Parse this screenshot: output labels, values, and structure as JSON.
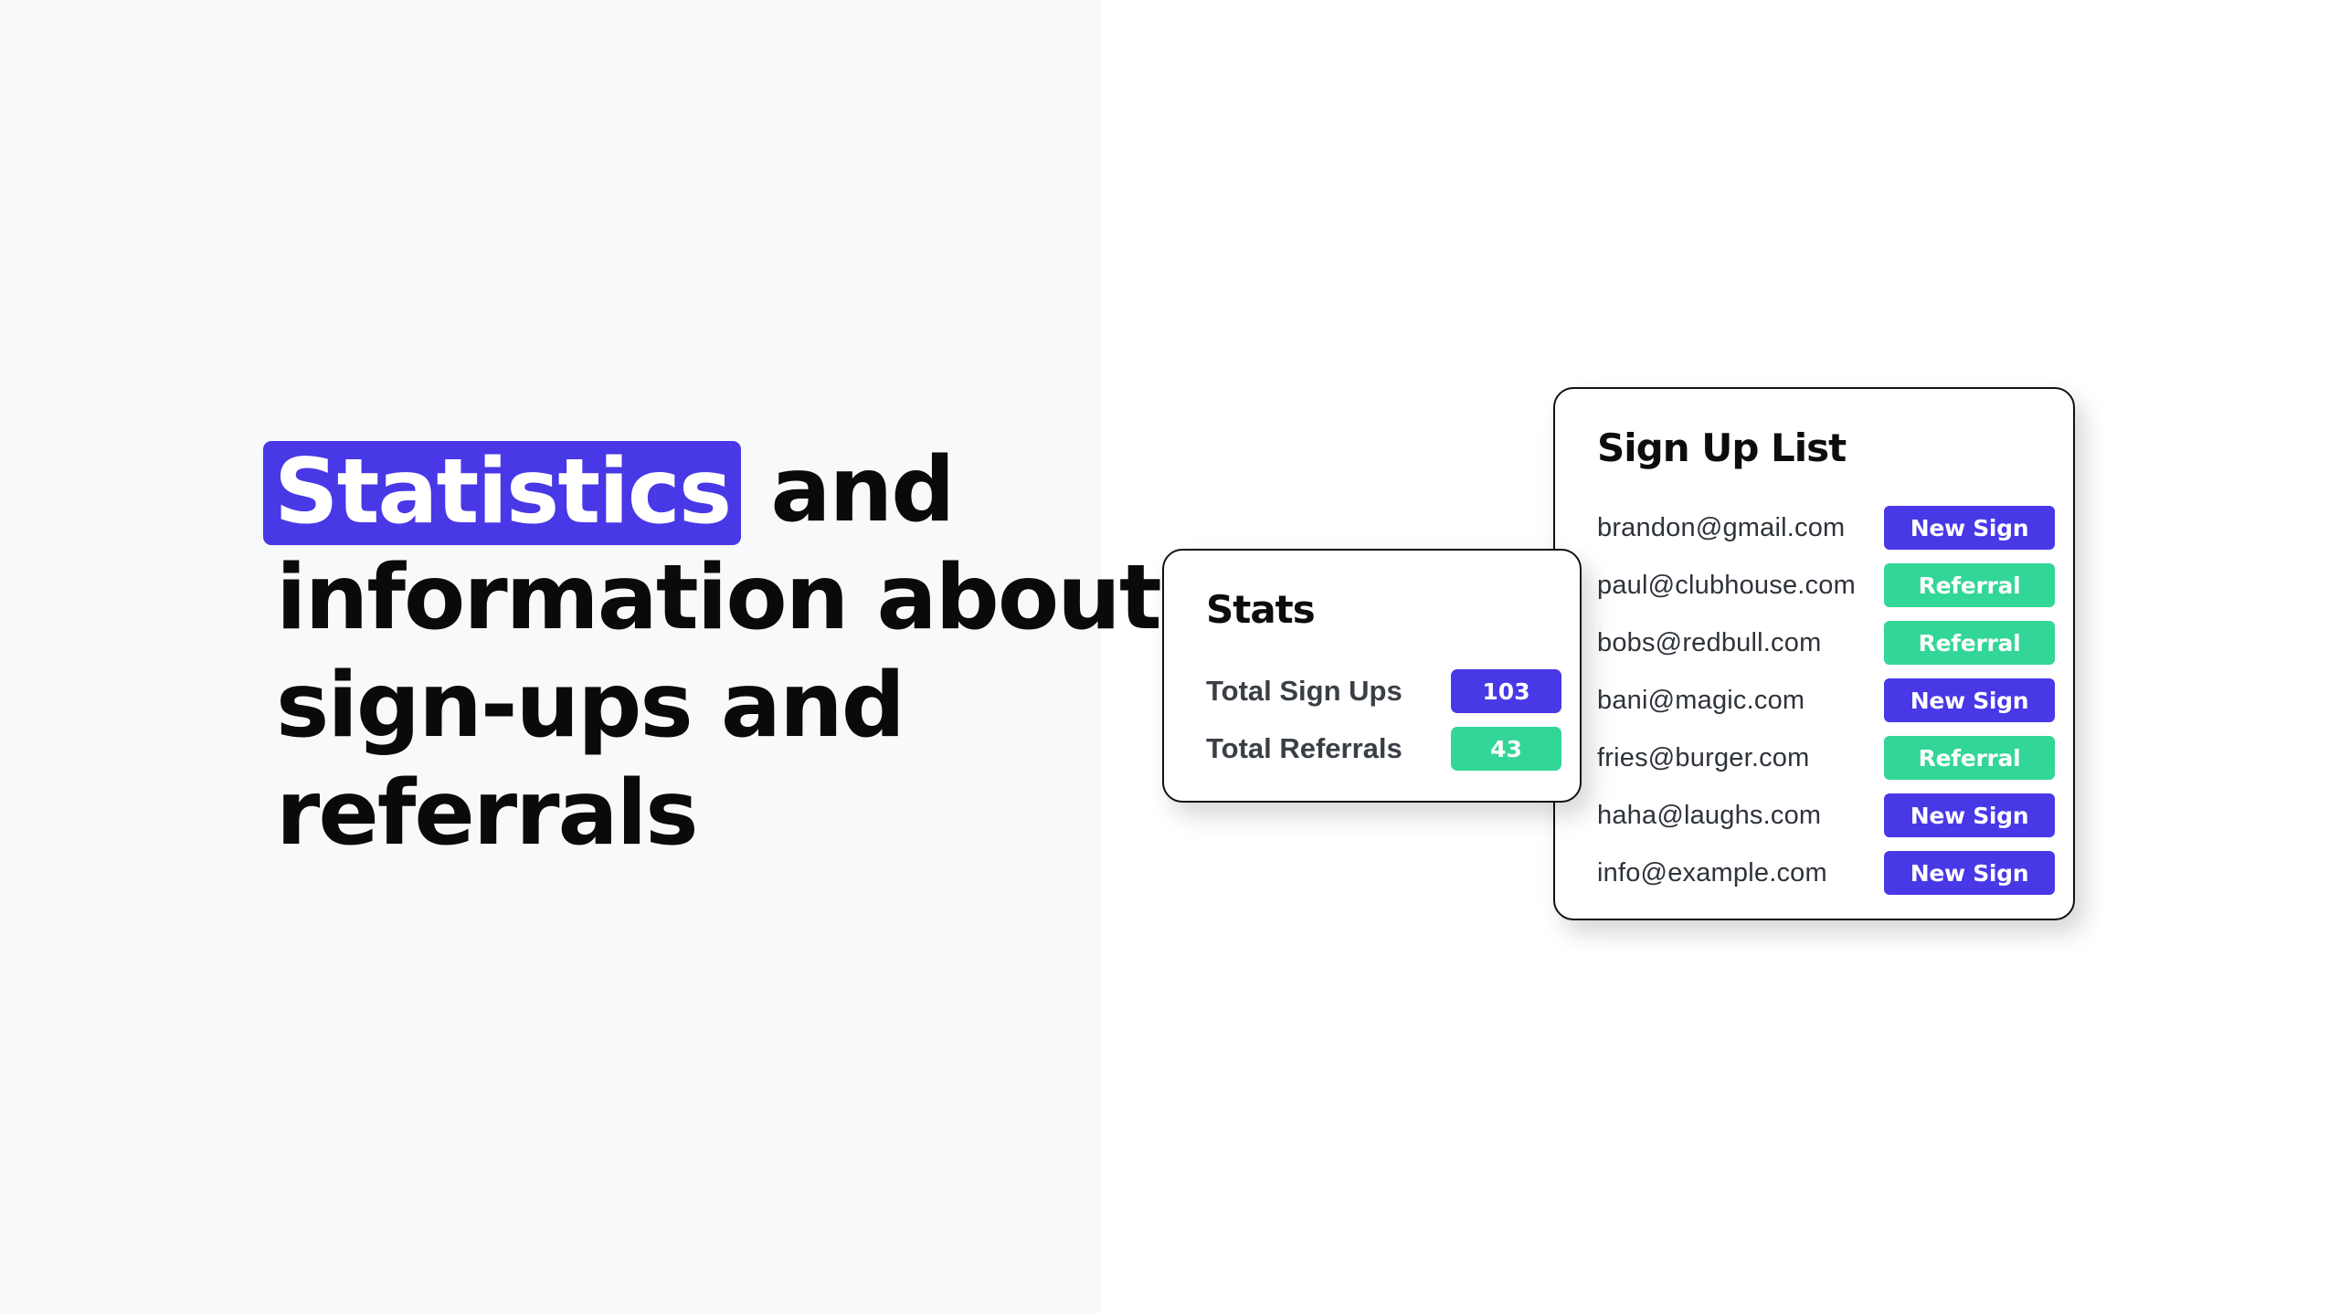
{
  "headline": {
    "highlight": "Statistics",
    "line1_rest": "and",
    "line2": "information about",
    "line3": "sign-ups and",
    "line4": "referrals"
  },
  "colors": {
    "accent_blue": "#4838e6",
    "accent_green": "#32d696"
  },
  "stats": {
    "title": "Stats",
    "items": [
      {
        "label": "Total Sign Ups",
        "value": "103",
        "color": "blue"
      },
      {
        "label": "Total Referrals",
        "value": "43",
        "color": "green"
      }
    ]
  },
  "signup_list": {
    "title": "Sign Up List",
    "rows": [
      {
        "email": "brandon@gmail.com",
        "type": "New Sign"
      },
      {
        "email": "paul@clubhouse.com",
        "type": "Referral"
      },
      {
        "email": "bobs@redbull.com",
        "type": "Referral"
      },
      {
        "email": "bani@magic.com",
        "type": "New Sign"
      },
      {
        "email": "fries@burger.com",
        "type": "Referral"
      },
      {
        "email": "haha@laughs.com",
        "type": "New Sign"
      },
      {
        "email": "info@example.com",
        "type": "New Sign"
      }
    ]
  }
}
